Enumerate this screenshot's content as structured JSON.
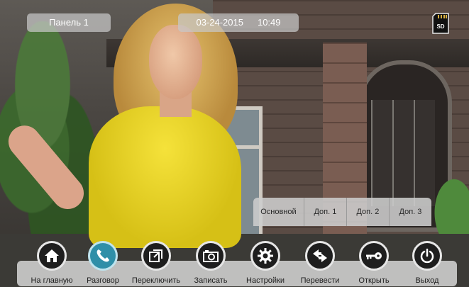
{
  "header": {
    "panel_label": "Панель 1",
    "date": "03-24-2015",
    "time": "10:49",
    "sd_label": "SD"
  },
  "submenu": {
    "items": [
      {
        "label": "Основной"
      },
      {
        "label": "Доп. 1"
      },
      {
        "label": "Доп. 2"
      },
      {
        "label": "Доп. 3"
      }
    ]
  },
  "dock": {
    "items": [
      {
        "label": "На главную",
        "icon": "home-icon"
      },
      {
        "label": "Разговор",
        "icon": "phone-icon",
        "active": true
      },
      {
        "label": "Переключить",
        "icon": "switch-icon"
      },
      {
        "label": "Записать",
        "icon": "camera-icon"
      },
      {
        "label": "Настройки",
        "icon": "gear-icon"
      },
      {
        "label": "Перевести",
        "icon": "transfer-icon"
      },
      {
        "label": "Открыть",
        "icon": "key-icon"
      },
      {
        "label": "Выход",
        "icon": "power-icon"
      }
    ],
    "active_color": "#2f8fa8"
  }
}
